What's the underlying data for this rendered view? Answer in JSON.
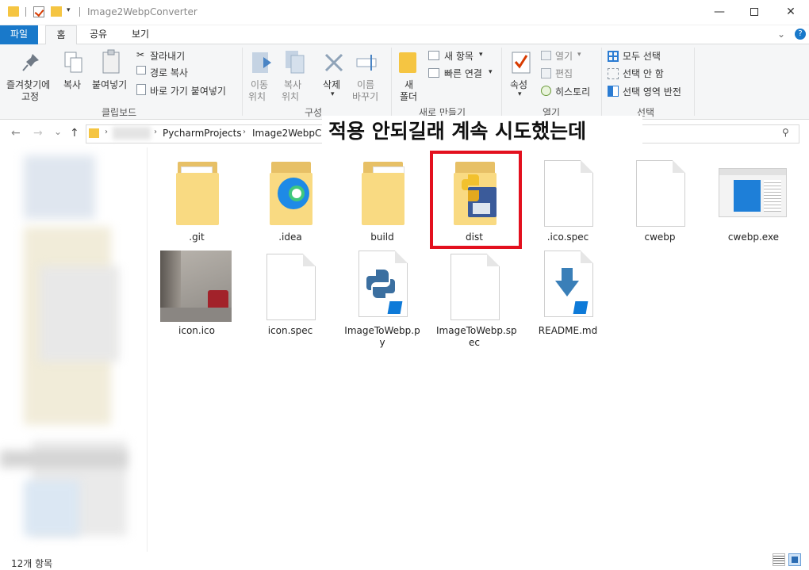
{
  "window": {
    "title": "Image2WebpConverter",
    "minimize_glyph": "—",
    "close_glyph": "✕"
  },
  "quick_access": {
    "dropdown_glyph": "▾"
  },
  "ribbon_tabs": {
    "file": "파일",
    "home": "홈",
    "share": "공유",
    "view": "보기",
    "collapse_glyph": "⌄",
    "help_glyph": "?"
  },
  "ribbon": {
    "clipboard": {
      "pin_line1": "즐겨찾기에",
      "pin_line2": "고정",
      "copy": "복사",
      "paste": "붙여넣기",
      "cut": "잘라내기",
      "copy_path": "경로 복사",
      "paste_shortcut": "바로 가기 붙여넣기",
      "group_label": "클립보드"
    },
    "organize": {
      "move_line1": "이동",
      "move_line2": "위치",
      "copy_line1": "복사",
      "copy_line2": "위치",
      "delete": "삭제",
      "rename_line1": "이름",
      "rename_line2": "바꾸기",
      "group_label": "구성"
    },
    "new": {
      "folder_line1": "새",
      "folder_line2": "폴더",
      "new_item": "새 항목",
      "easy_access": "빠른 연결",
      "group_label": "새로 만들기"
    },
    "open": {
      "properties": "속성",
      "open": "열기",
      "edit": "편집",
      "history": "히스토리",
      "group_label": "열기"
    },
    "select": {
      "select_all": "모두 선택",
      "select_none": "선택 안 함",
      "invert": "선택 영역 반전",
      "group_label": "선택"
    }
  },
  "address_bar": {
    "back": "←",
    "forward": "→",
    "recent": "⌄",
    "up": "↑",
    "chevron": "›",
    "crumb_1": "PycharmProjects",
    "crumb_2": "Image2WebpCo",
    "search_glyph": "⚲"
  },
  "overlay_caption": "적용 안되길래 계속 시도했는데",
  "files": [
    {
      "name": ".git",
      "kind": "folder"
    },
    {
      "name": ".idea",
      "kind": "folder-edge"
    },
    {
      "name": "build",
      "kind": "folder"
    },
    {
      "name": "dist",
      "kind": "folder-python"
    },
    {
      "name": ".ico.spec",
      "kind": "doc"
    },
    {
      "name": "cwebp",
      "kind": "doc"
    },
    {
      "name": "cwebp.exe",
      "kind": "exe"
    },
    {
      "name": "icon.ico",
      "kind": "image"
    },
    {
      "name": "icon.spec",
      "kind": "doc"
    },
    {
      "name_line1": "ImageToWebp.p",
      "name_line2": "y",
      "kind": "python"
    },
    {
      "name_line1": "ImageToWebp.sp",
      "name_line2": "ec",
      "kind": "doc"
    },
    {
      "name": "README.md",
      "kind": "markdown"
    }
  ],
  "status": {
    "item_count": "12개 항목"
  },
  "colors": {
    "accent": "#1979ca",
    "highlight": "#e3101e",
    "folder": "#f9da82"
  }
}
